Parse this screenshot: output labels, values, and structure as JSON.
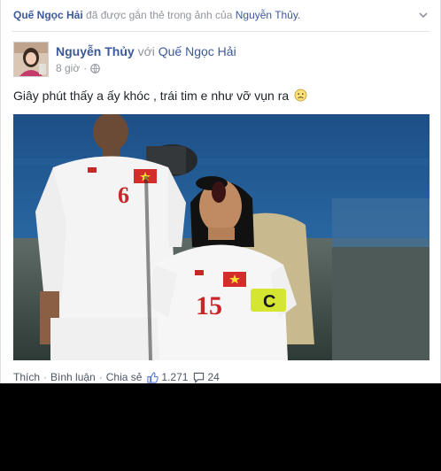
{
  "story": {
    "actor": "Quế Ngọc Hải",
    "action_text": "đã được gắn thẻ trong ảnh của",
    "tagged_owner": "Nguyễn Thủy."
  },
  "post": {
    "author": "Nguyễn Thủy",
    "with_text": "với",
    "with_name": "Quế Ngọc Hải",
    "time": "8 giờ",
    "text": "Giây phút thấy a ấy khóc , trái tim e như vỡ vụn ra",
    "emoji_icon": "sad-face-icon",
    "photo_jersey_numbers": [
      "6",
      "15"
    ],
    "captain_band_letter": "C"
  },
  "actions": {
    "like": "Thích",
    "comment": "Bình luận",
    "share": "Chia sẻ",
    "like_count": "1.271",
    "comment_count": "24"
  },
  "colors": {
    "link": "#3b5998",
    "muted": "#90949c",
    "jersey": "#f4f4f4",
    "number_red": "#c62828",
    "captain_band": "#d4e632"
  }
}
